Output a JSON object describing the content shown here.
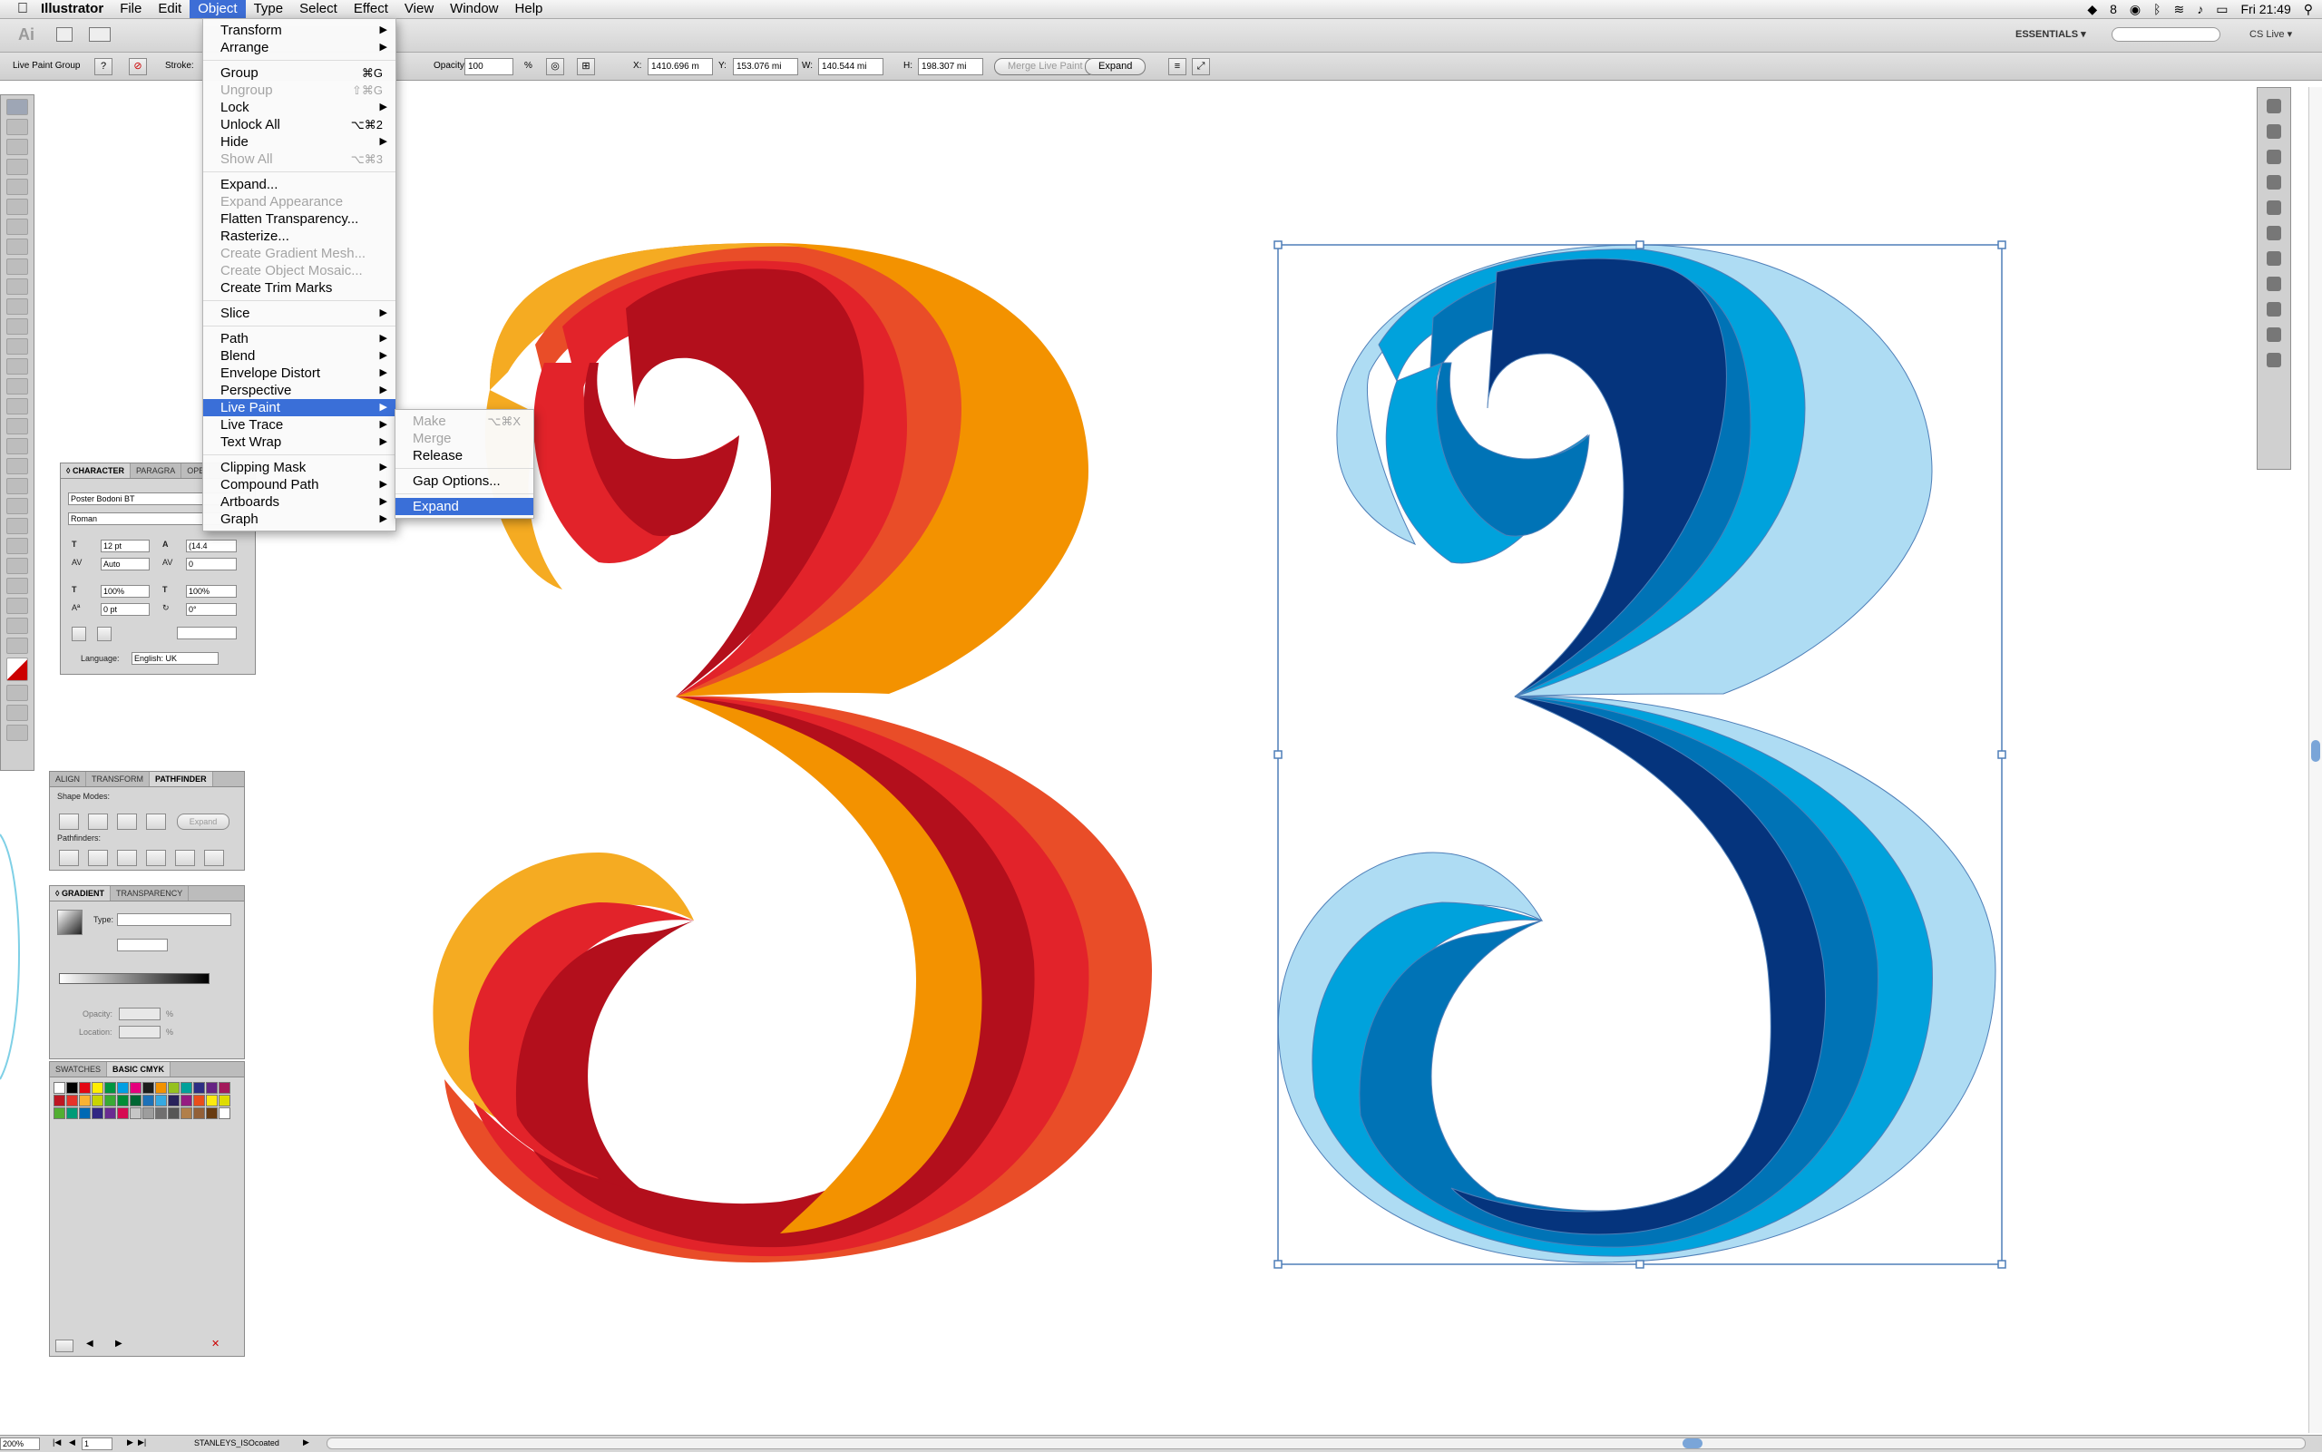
{
  "menubar": {
    "apple": "",
    "app_name": "Illustrator",
    "items": [
      "File",
      "Edit",
      "Object",
      "Type",
      "Select",
      "Effect",
      "View",
      "Window",
      "Help"
    ],
    "active_item": "Object",
    "status_right": {
      "badge": "8",
      "clock": "Fri 21:49"
    }
  },
  "appbar": {
    "logo": "Ai",
    "workspace": "ESSENTIALS ▾",
    "cs_live": "CS Live ▾"
  },
  "control_bar": {
    "selection": "Live Paint Group",
    "stroke_label": "Stroke:",
    "opacity_label": "Opacity:",
    "opacity_value": "100",
    "opacity_unit": "%",
    "x_label": "X:",
    "x_value": "1410.696 m",
    "y_label": "Y:",
    "y_value": "153.076 mi",
    "w_label": "W:",
    "w_value": "140.544 mi",
    "h_label": "H:",
    "h_value": "198.307 mi",
    "merge_button": "Merge Live Paint",
    "expand_button": "Expand"
  },
  "object_menu": [
    {
      "label": "Transform",
      "arrow": true
    },
    {
      "label": "Arrange",
      "arrow": true
    },
    {
      "sep": true
    },
    {
      "label": "Group",
      "shortcut": "⌘G"
    },
    {
      "label": "Ungroup",
      "shortcut": "⇧⌘G",
      "disabled": true
    },
    {
      "label": "Lock",
      "arrow": true
    },
    {
      "label": "Unlock All",
      "shortcut": "⌥⌘2"
    },
    {
      "label": "Hide",
      "arrow": true
    },
    {
      "label": "Show All",
      "shortcut": "⌥⌘3",
      "disabled": true
    },
    {
      "sep": true
    },
    {
      "label": "Expand..."
    },
    {
      "label": "Expand Appearance",
      "disabled": true
    },
    {
      "label": "Flatten Transparency..."
    },
    {
      "label": "Rasterize..."
    },
    {
      "label": "Create Gradient Mesh...",
      "disabled": true
    },
    {
      "label": "Create Object Mosaic...",
      "disabled": true
    },
    {
      "label": "Create Trim Marks"
    },
    {
      "sep": true
    },
    {
      "label": "Slice",
      "arrow": true
    },
    {
      "sep": true
    },
    {
      "label": "Path",
      "arrow": true
    },
    {
      "label": "Blend",
      "arrow": true
    },
    {
      "label": "Envelope Distort",
      "arrow": true
    },
    {
      "label": "Perspective",
      "arrow": true
    },
    {
      "label": "Live Paint",
      "arrow": true,
      "highlighted": true
    },
    {
      "label": "Live Trace",
      "arrow": true
    },
    {
      "label": "Text Wrap",
      "arrow": true
    },
    {
      "sep": true
    },
    {
      "label": "Clipping Mask",
      "arrow": true
    },
    {
      "label": "Compound Path",
      "arrow": true
    },
    {
      "label": "Artboards",
      "arrow": true
    },
    {
      "label": "Graph",
      "arrow": true
    }
  ],
  "livepaint_submenu": [
    {
      "label": "Make",
      "shortcut": "⌥⌘X",
      "disabled": true
    },
    {
      "label": "Merge",
      "disabled": true
    },
    {
      "label": "Release"
    },
    {
      "sep": true
    },
    {
      "label": "Gap Options..."
    },
    {
      "sep": true
    },
    {
      "label": "Expand",
      "highlighted": true
    }
  ],
  "character_panel": {
    "tabs": [
      "◊ CHARACTER",
      "PARAGRA",
      "OPE"
    ],
    "font": "Poster Bodoni BT",
    "style": "Roman",
    "size": "12 pt",
    "leading": "(14.4",
    "kerning": "Auto",
    "tracking": "0",
    "vscale": "100%",
    "hscale": "100%",
    "baseline": "0 pt",
    "rotation": "0°",
    "language_label": "Language:",
    "language": "English: UK"
  },
  "pathfinder_panel": {
    "tabs": [
      "ALIGN",
      "TRANSFORM",
      "PATHFINDER"
    ],
    "shape_modes": "Shape Modes:",
    "pathfinders": "Pathfinders:",
    "expand": "Expand"
  },
  "gradient_panel": {
    "tabs": [
      "◊ GRADIENT",
      "TRANSPARENCY"
    ],
    "type_label": "Type:",
    "opacity_label": "Opacity:",
    "location_label": "Location:",
    "pct": "%"
  },
  "swatches_panel": {
    "tabs": [
      "SWATCHES",
      "BASIC CMYK"
    ],
    "colors": [
      "#ffffff",
      "#000000",
      "#e30613",
      "#ffed00",
      "#009640",
      "#009fe3",
      "#e5007d",
      "#1d1d1b",
      "#f39200",
      "#95c11f",
      "#00a19a",
      "#2d2e83",
      "#662483",
      "#a3195b",
      "#be1622",
      "#e6332a",
      "#f9b233",
      "#c8d400",
      "#3aaa35",
      "#008d36",
      "#006633",
      "#1d71b8",
      "#36a9e1",
      "#29235c",
      "#951b81",
      "#e94e1b",
      "#fcea10",
      "#dedc00",
      "#52ae32",
      "#009b77",
      "#0069b4",
      "#312783",
      "#6a2c91",
      "#d60b52",
      "#c6c6c6",
      "#9d9d9d",
      "#706f6f",
      "#575756",
      "#b17f4a",
      "#936037",
      "#683c11",
      "#ffffff"
    ]
  },
  "status_bar": {
    "zoom": "200%",
    "page": "1",
    "profile": "STANLEYS_ISOcoated"
  },
  "artwork": {
    "warm_colors": [
      "#f5ab22",
      "#e94d28",
      "#e2232a",
      "#b30f1c",
      "#f39200"
    ],
    "cool_colors": [
      "#aedcf3",
      "#00a2dc",
      "#0073b6",
      "#05347d"
    ]
  }
}
